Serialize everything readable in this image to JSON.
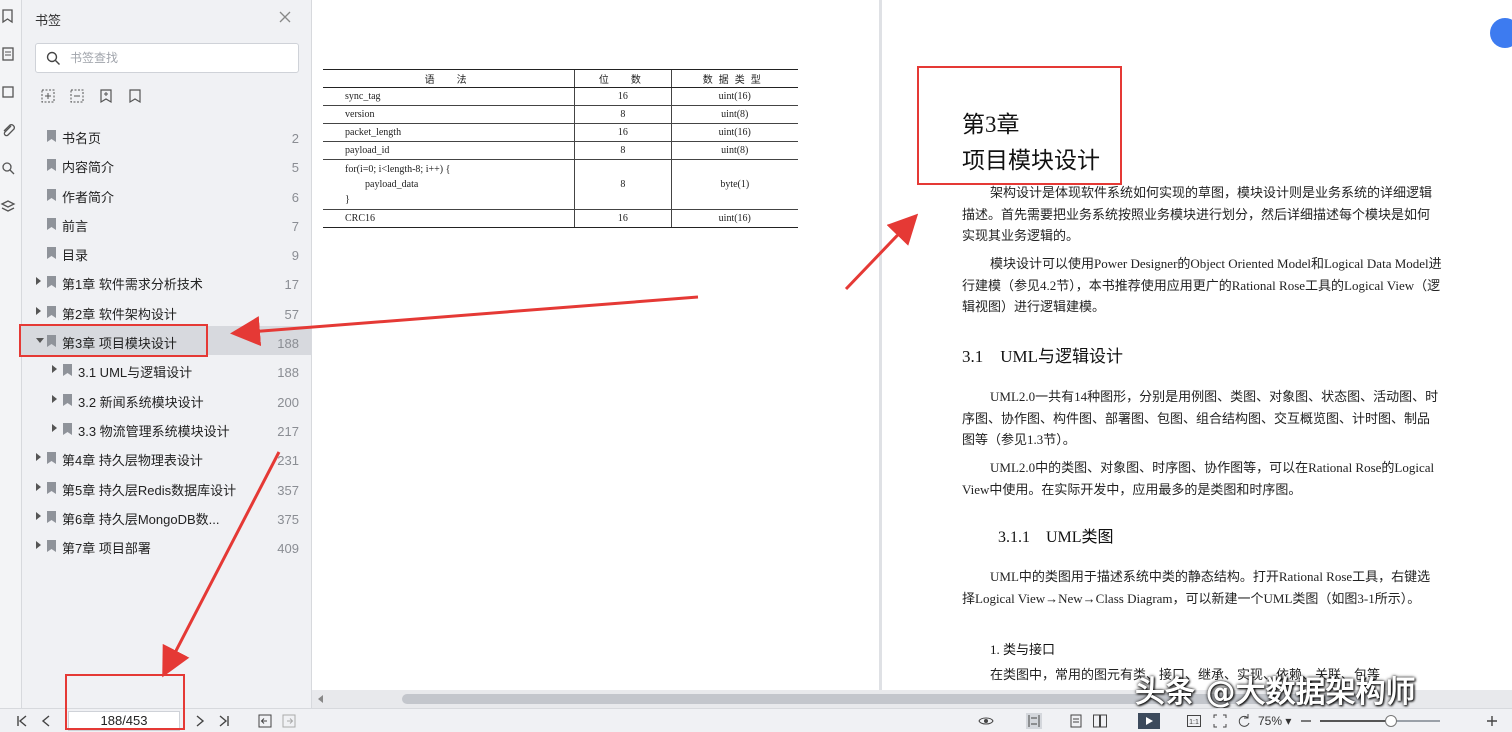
{
  "sidebar": {
    "title": "书签",
    "search_placeholder": "书签查找",
    "items": [
      {
        "label": "书名页",
        "page": "2",
        "level": 0,
        "expandable": false
      },
      {
        "label": "内容简介",
        "page": "5",
        "level": 0,
        "expandable": false
      },
      {
        "label": "作者简介",
        "page": "6",
        "level": 0,
        "expandable": false
      },
      {
        "label": "前言",
        "page": "7",
        "level": 0,
        "expandable": false
      },
      {
        "label": "目录",
        "page": "9",
        "level": 0,
        "expandable": false
      },
      {
        "label": "第1章 软件需求分析技术",
        "page": "17",
        "level": 0,
        "expandable": true
      },
      {
        "label": "第2章 软件架构设计",
        "page": "57",
        "level": 0,
        "expandable": true
      },
      {
        "label": "第3章 项目模块设计",
        "page": "188",
        "level": 0,
        "expandable": true,
        "expanded": true,
        "selected": true
      },
      {
        "label": "3.1 UML与逻辑设计",
        "page": "188",
        "level": 1,
        "expandable": true
      },
      {
        "label": "3.2 新闻系统模块设计",
        "page": "200",
        "level": 1,
        "expandable": true
      },
      {
        "label": "3.3 物流管理系统模块设计",
        "page": "217",
        "level": 1,
        "expandable": true
      },
      {
        "label": "第4章 持久层物理表设计",
        "page": "231",
        "level": 0,
        "expandable": true
      },
      {
        "label": "第5章 持久层Redis数据库设计",
        "page": "357",
        "level": 0,
        "expandable": true
      },
      {
        "label": "第6章 持久层MongoDB数...",
        "page": "375",
        "level": 0,
        "expandable": true
      },
      {
        "label": "第7章 项目部署",
        "page": "409",
        "level": 0,
        "expandable": true
      }
    ]
  },
  "left_page": {
    "table": {
      "headers": [
        "语　法",
        "位　数",
        "数据类型"
      ],
      "rows": [
        [
          "sync_tag",
          "16",
          "uint(16)"
        ],
        [
          "version",
          "8",
          "uint(8)"
        ],
        [
          "packet_length",
          "16",
          "uint(16)"
        ],
        [
          "payload_id",
          "8",
          "uint(8)"
        ],
        [
          "for(i=0; i<length-8; i++) {\n        payload_data\n}",
          "8",
          "byte(1)"
        ],
        [
          "CRC16",
          "16",
          "uint(16)"
        ]
      ]
    }
  },
  "right_page": {
    "chapter_num": "第3章",
    "chapter_title": "项目模块设计",
    "para1": "架构设计是体现软件系统如何实现的草图，模块设计则是业务系统的详细逻辑描述。首先需要把业务系统按照业务模块进行划分，然后详细描述每个模块是如何实现其业务逻辑的。",
    "para2": "模块设计可以使用Power Designer的Object Oriented Model和Logical Data Model进行建模（参见4.2节），本书推荐使用应用更广的Rational Rose工具的Logical View（逻辑视图）进行逻辑建模。",
    "h_31": "3.1　UML与逻辑设计",
    "para3": "UML2.0一共有14种图形，分别是用例图、类图、对象图、状态图、活动图、时序图、协作图、构件图、部署图、包图、组合结构图、交互概览图、计时图、制品图等（参见1.3节）。",
    "para4": "UML2.0中的类图、对象图、时序图、协作图等，可以在Rational Rose的Logical View中使用。在实际开发中，应用最多的是类图和时序图。",
    "h_311": "3.1.1　UML类图",
    "para5": "UML中的类图用于描述系统中类的静态结构。打开Rational Rose工具，右键选择Logical View→New→Class Diagram，可以新建一个UML类图（如图3-1所示）。",
    "h_1": "1. 类与接口",
    "para6": "在类图中，常用的图元有类、接口、继承、实现、依赖、关联、包等"
  },
  "watermark": "头条 @大数据架构师",
  "statusbar": {
    "page_indicator": "188/453",
    "zoom_label": "75%",
    "zoom_percent": 75
  },
  "colors": {
    "highlight": "#e53935",
    "panel_bg": "#f0f1f4",
    "accent": "#3d7bf0"
  }
}
